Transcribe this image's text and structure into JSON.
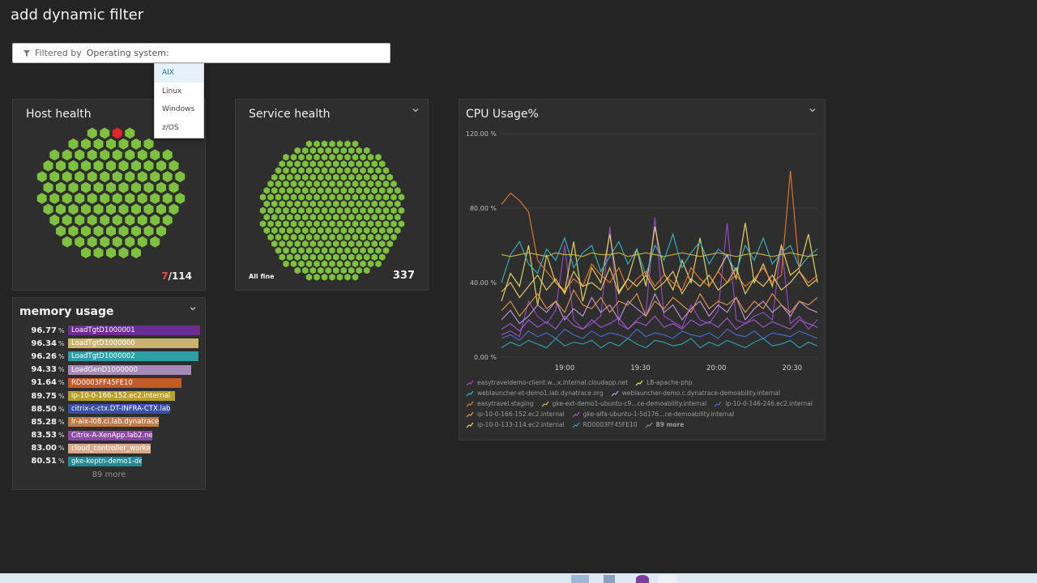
{
  "page": {
    "title": "add dynamic filter"
  },
  "filter": {
    "label": "Filtered by",
    "value": "Operating system:"
  },
  "dropdown": {
    "options": [
      "AIX",
      "Linux",
      "Windows",
      "z/OS"
    ],
    "active_index": 0
  },
  "host_health": {
    "title": "Host health",
    "count_bad": "7",
    "count_total": "/114",
    "colors": {
      "ok": "#7ec13f",
      "bad": "#e5242b"
    }
  },
  "service_health": {
    "title": "Service health",
    "status": "All fine",
    "count": "337",
    "colors": {
      "ok": "#7ec13f"
    }
  },
  "cpu": {
    "title": "CPU Usage%",
    "legend": [
      {
        "name": "easytraveldemo-client.w...x.internal.cloudapp.net",
        "color": "#9b4dca"
      },
      {
        "name": "LB-apache-php",
        "color": "#f2e26b"
      },
      {
        "name": "weblauncher-et-demo1.lab.dynatrace.org",
        "color": "#39b8c6"
      },
      {
        "name": "weblauncher-demo.c.dynatrace-demoability.internal",
        "color": "#c79be0"
      },
      {
        "name": "easytravel.staging",
        "color": "#ef7a2c"
      },
      {
        "name": "gke-ext-demo1-ubuntu-c9...ce-demoability.internal",
        "color": "#d4b93b"
      },
      {
        "name": "ip-10-0-146-246.ec2.internal",
        "color": "#4c6fd6"
      },
      {
        "name": "ip-10-0-166-152.ec2.internal",
        "color": "#e89a4a"
      },
      {
        "name": "gke-alfa-ubuntu-1-5d176...ce-demoability.internal",
        "color": "#a55bd4"
      },
      {
        "name": "ip-10-0-133-114.ec2.internal",
        "color": "#f0d46a"
      },
      {
        "name": "RD0003FF45FE10",
        "color": "#2ea7b5"
      }
    ],
    "more_label": "89 more"
  },
  "chart_data": {
    "type": "line",
    "title": "CPU Usage%",
    "xlabel": "",
    "ylabel": "",
    "yticks": [
      "120.00 %",
      "80.00 %",
      "40.00 %",
      "0.00 %"
    ],
    "ylim": [
      0,
      120
    ],
    "xticks": [
      "19:00",
      "19:30",
      "20:00",
      "20:30"
    ],
    "x_range": [
      "18:35",
      "20:40"
    ],
    "legend_position": "bottom",
    "series": [
      {
        "name": "easytraveldemo-client.w...x.internal.cloudapp.net",
        "color": "#9b4dca",
        "values": [
          12,
          14,
          11,
          30,
          22,
          18,
          25,
          60,
          20,
          15,
          18,
          22,
          70,
          18,
          15,
          20,
          24,
          75,
          22,
          19,
          16,
          28,
          20,
          18,
          25,
          72,
          20,
          18,
          22,
          24,
          20,
          60,
          18,
          22,
          15,
          20
        ]
      },
      {
        "name": "LB-apache-php",
        "color": "#f2e26b",
        "values": [
          30,
          45,
          38,
          60,
          28,
          55,
          40,
          35,
          62,
          30,
          48,
          40,
          66,
          35,
          42,
          58,
          38,
          70,
          45,
          36,
          52,
          40,
          64,
          38,
          46,
          55,
          42,
          72,
          40,
          50,
          38,
          60,
          44,
          48,
          66,
          40
        ]
      },
      {
        "name": "weblauncher-et-demo1.lab.dynatrace.org",
        "color": "#39b8c6",
        "values": [
          40,
          55,
          62,
          50,
          45,
          58,
          52,
          64,
          48,
          56,
          60,
          46,
          54,
          62,
          50,
          58,
          44,
          60,
          52,
          66,
          48,
          56,
          62,
          50,
          58,
          54,
          46,
          60,
          52,
          64,
          50,
          56,
          60,
          48,
          54,
          58
        ]
      },
      {
        "name": "weblauncher-demo.c.dynatrace-demoability.internal",
        "color": "#c79be0",
        "values": [
          20,
          25,
          18,
          22,
          28,
          24,
          30,
          20,
          26,
          22,
          32,
          24,
          28,
          20,
          30,
          26,
          22,
          34,
          24,
          28,
          20,
          26,
          30,
          22,
          28,
          24,
          32,
          20,
          26,
          30,
          24,
          28,
          22,
          30,
          26,
          24
        ]
      },
      {
        "name": "easytravel.staging",
        "color": "#ef7a2c",
        "values": [
          82,
          88,
          84,
          78,
          52,
          46,
          40,
          36,
          42,
          38,
          50,
          44,
          40,
          48,
          36,
          42,
          46,
          38,
          44,
          40,
          36,
          48,
          42,
          38,
          46,
          40,
          44,
          38,
          42,
          48,
          40,
          44,
          100,
          46,
          40,
          44
        ]
      },
      {
        "name": "gke-ext-demo1-ubuntu-c9...ce-demoability.internal",
        "color": "#d4b93b",
        "values": [
          55,
          54,
          55,
          56,
          55,
          54,
          56,
          55,
          55,
          54,
          56,
          55,
          55,
          56,
          54,
          55,
          56,
          55,
          54,
          55,
          56,
          55,
          54,
          55,
          56,
          55,
          54,
          55,
          56,
          55,
          54,
          55,
          56,
          55,
          54,
          55
        ]
      },
      {
        "name": "ip-10-0-146-246.ec2.internal",
        "color": "#4c6fd6",
        "values": [
          10,
          12,
          9,
          14,
          11,
          13,
          10,
          15,
          12,
          10,
          14,
          11,
          13,
          12,
          10,
          15,
          11,
          13,
          12,
          10,
          14,
          12,
          11,
          13,
          10,
          15,
          12,
          11,
          14,
          10,
          13,
          12,
          11,
          14,
          12,
          10
        ]
      },
      {
        "name": "ip-10-0-166-152.ec2.internal",
        "color": "#e89a4a",
        "values": [
          25,
          30,
          22,
          28,
          34,
          26,
          30,
          24,
          36,
          28,
          26,
          32,
          24,
          30,
          28,
          34,
          22,
          30,
          26,
          32,
          28,
          24,
          34,
          26,
          30,
          28,
          32,
          24,
          30,
          26,
          34,
          28,
          24,
          30,
          28,
          32
        ]
      },
      {
        "name": "gke-alfa-ubuntu-1-5d176...ce-demoability.internal",
        "color": "#a55bd4",
        "values": [
          15,
          18,
          14,
          20,
          16,
          19,
          15,
          22,
          17,
          15,
          20,
          16,
          18,
          21,
          15,
          19,
          17,
          22,
          16,
          18,
          15,
          20,
          17,
          19,
          16,
          21,
          15,
          18,
          20,
          16,
          19,
          17,
          15,
          20,
          18,
          16
        ]
      },
      {
        "name": "ip-10-0-133-114.ec2.internal",
        "color": "#f0d46a",
        "values": [
          35,
          40,
          32,
          38,
          44,
          36,
          42,
          34,
          46,
          38,
          40,
          36,
          48,
          34,
          42,
          38,
          44,
          36,
          40,
          46,
          34,
          42,
          38,
          44,
          36,
          40,
          48,
          34,
          42,
          38,
          44,
          36,
          40,
          46,
          38,
          42
        ]
      },
      {
        "name": "RD0003FF45FE10",
        "color": "#2ea7b5",
        "values": [
          5,
          8,
          6,
          9,
          7,
          5,
          10,
          6,
          8,
          7,
          9,
          5,
          8,
          6,
          10,
          7,
          5,
          9,
          8,
          6,
          7,
          10,
          5,
          8,
          6,
          9,
          7,
          5,
          8,
          10,
          6,
          7,
          9,
          5,
          8,
          6
        ]
      }
    ]
  },
  "memory": {
    "title": "memory usage",
    "unit": "%",
    "rows": [
      {
        "value": "96.77",
        "name": "LoadTgtD1000001",
        "pct": 96.77,
        "color": "#6b2e8e"
      },
      {
        "value": "96.34",
        "name": "LoadTgtD1000000",
        "pct": 96.34,
        "color": "#c9b46a"
      },
      {
        "value": "96.26",
        "name": "LoadTgtD1000002",
        "pct": 96.26,
        "color": "#2e9ea6"
      },
      {
        "value": "94.33",
        "name": "LoadGenD1000000",
        "pct": 94.33,
        "color": "#a78ab8"
      },
      {
        "value": "91.64",
        "name": "RD0003FF45FE10",
        "pct": 91.64,
        "color": "#c4592a"
      },
      {
        "value": "89.75",
        "name": "ip-10-0-166-152.ec2.internal",
        "pct": 89.75,
        "color": "#b8a12a"
      },
      {
        "value": "88.50",
        "name": "citrix-c-ctx.DT-INFRA-CTX.lab",
        "pct": 88.5,
        "color": "#3b4fa8"
      },
      {
        "value": "85.28",
        "name": "lr-aix-l08.ci.lab.dynatrace.org",
        "pct": 85.28,
        "color": "#c07a4a"
      },
      {
        "value": "83.53",
        "name": "Citrix-A-XenApp.lab2.net",
        "pct": 83.53,
        "color": "#8a49a6"
      },
      {
        "value": "83.00",
        "name": "cloud_controller_worker/5989d69...",
        "pct": 83.0,
        "color": "#d9a98a"
      },
      {
        "value": "80.51",
        "name": "gke-keptn-demo1-demo-1-e5b83...",
        "pct": 80.51,
        "color": "#1f8c94"
      }
    ],
    "more_label": "89 more"
  }
}
